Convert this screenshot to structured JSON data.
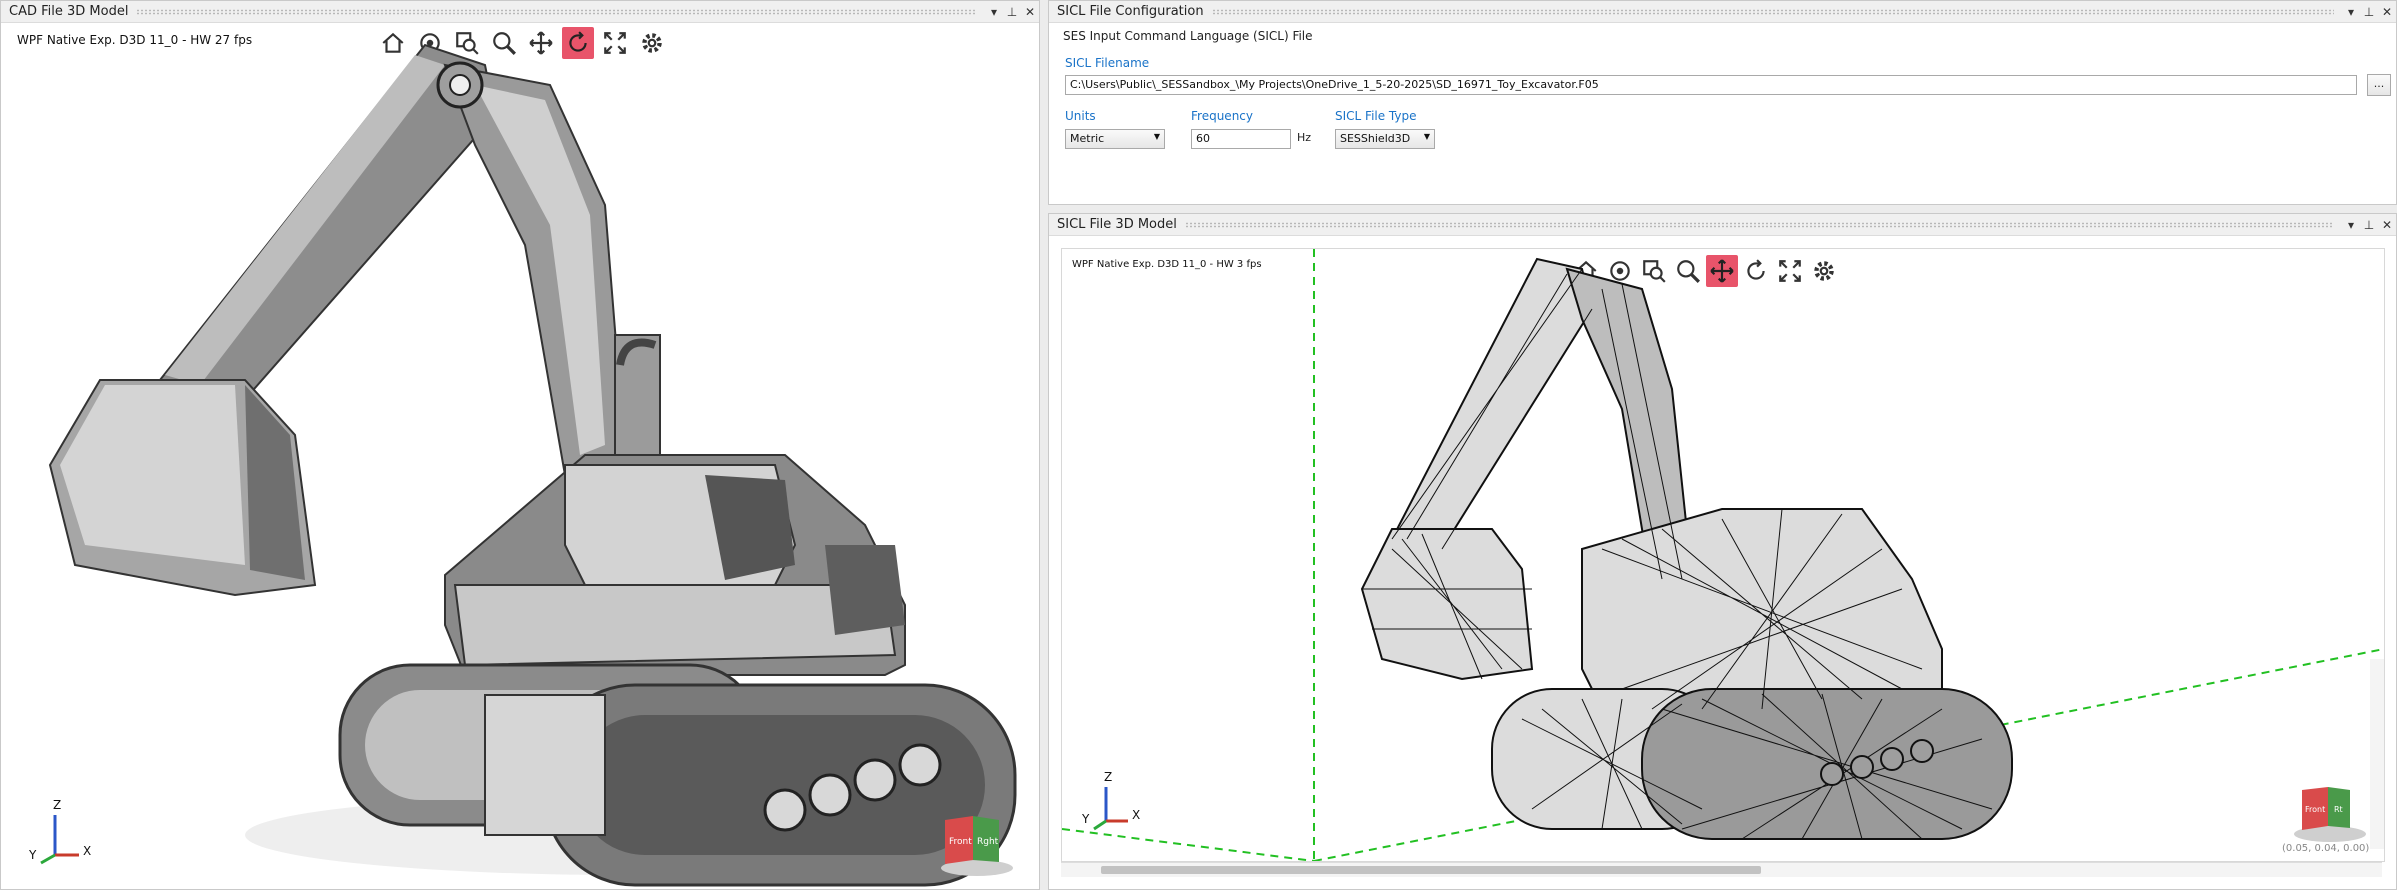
{
  "left_panel": {
    "title": "CAD File 3D Model",
    "hud_text": "WPF Native Exp. D3D 11_0 - HW    27 fps",
    "axis": {
      "z": "Z",
      "x": "X",
      "y": "Y"
    },
    "cube": {
      "front": "Front",
      "right": "Rght"
    }
  },
  "config_panel": {
    "title": "SICL File Configuration",
    "group_header": "SES Input Command Language (SICL) File",
    "filename_label": "SICL Filename",
    "filename_value": "C:\\Users\\Public\\_SESSandbox_\\My Projects\\OneDrive_1_5-20-2025\\SD_16971_Toy_Excavator.F05",
    "browse_label": "...",
    "units_label": "Units",
    "units_value": "Metric",
    "frequency_label": "Frequency",
    "frequency_value": "60",
    "frequency_unit": "Hz",
    "filetype_label": "SICL File Type",
    "filetype_value": "SESShield3D"
  },
  "right_panel": {
    "title": "SICL File 3D Model",
    "hud_text": "WPF Native Exp. D3D 11_0 - HW   3 fps",
    "axis": {
      "z": "Z",
      "x": "X",
      "y": "Y"
    },
    "cube": {
      "front": "Front",
      "right": "Rt"
    },
    "coords": "(0.05, 0.04, 0.00)"
  },
  "titlebar_buttons": {
    "pin": "⊓",
    "dropdown": "▾",
    "close": "✕"
  },
  "toolbar_icons": [
    "home-icon",
    "camera-icon",
    "zoom-window-icon",
    "zoom-icon",
    "pan-icon",
    "rotate-icon",
    "fit-icon",
    "settings-icon"
  ],
  "colors": {
    "accent_active": "#e8546a",
    "label_blue": "#1a73c8",
    "grid_green": "#22c022"
  }
}
